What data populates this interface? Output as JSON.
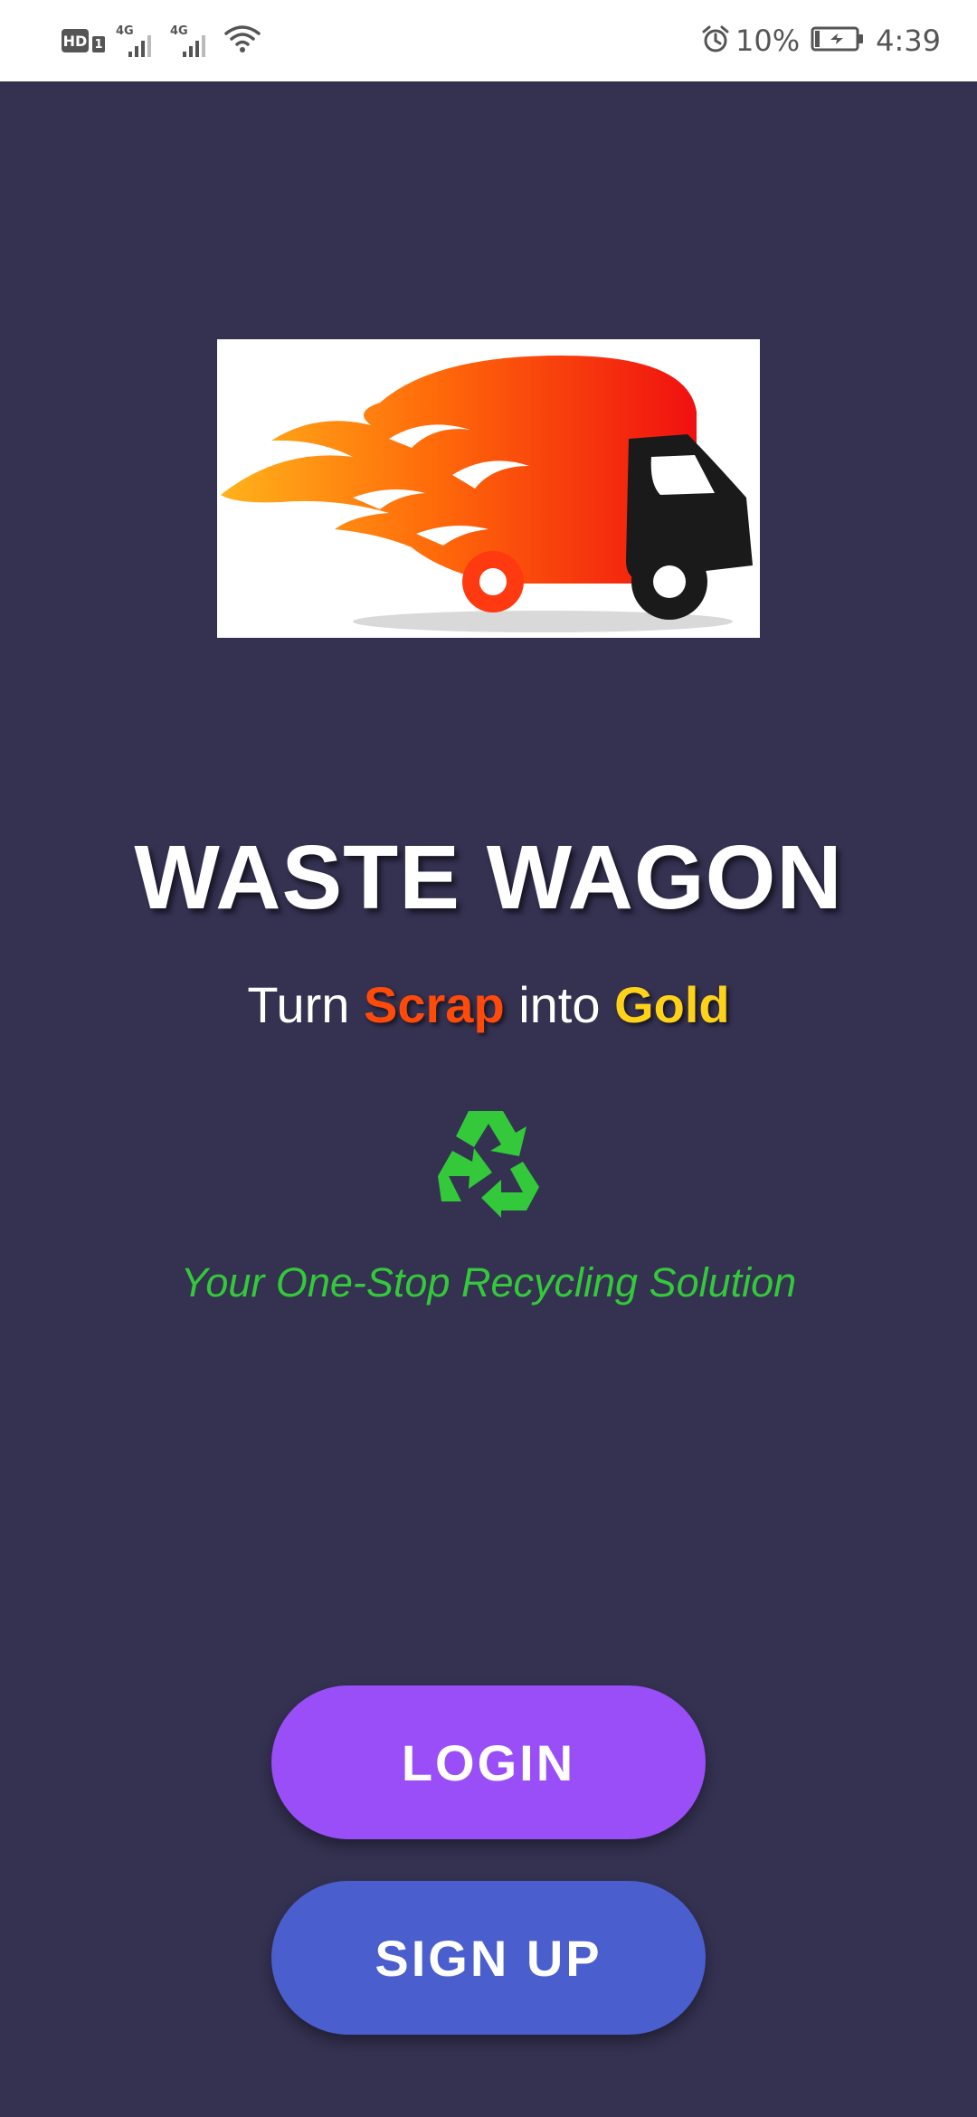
{
  "status_bar": {
    "hd_label": "HD",
    "sim_label": "1",
    "net1": "4G",
    "net2": "4G",
    "battery_percent": "10%",
    "time": "4:39"
  },
  "app": {
    "title": "WASTE WAGON",
    "tagline_turn": "Turn",
    "tagline_scrap": "Scrap",
    "tagline_into": "into",
    "tagline_gold": "Gold",
    "subtitle": "Your One-Stop Recycling Solution"
  },
  "buttons": {
    "login": "LOGIN",
    "signup": "SIGN UP"
  },
  "colors": {
    "background": "#343151",
    "scrap": "#ff4a0a",
    "gold": "#ffd21a",
    "subtitle": "#33c93a",
    "login_button": "#9a4ef7",
    "signup_button": "#4a5ecd"
  }
}
